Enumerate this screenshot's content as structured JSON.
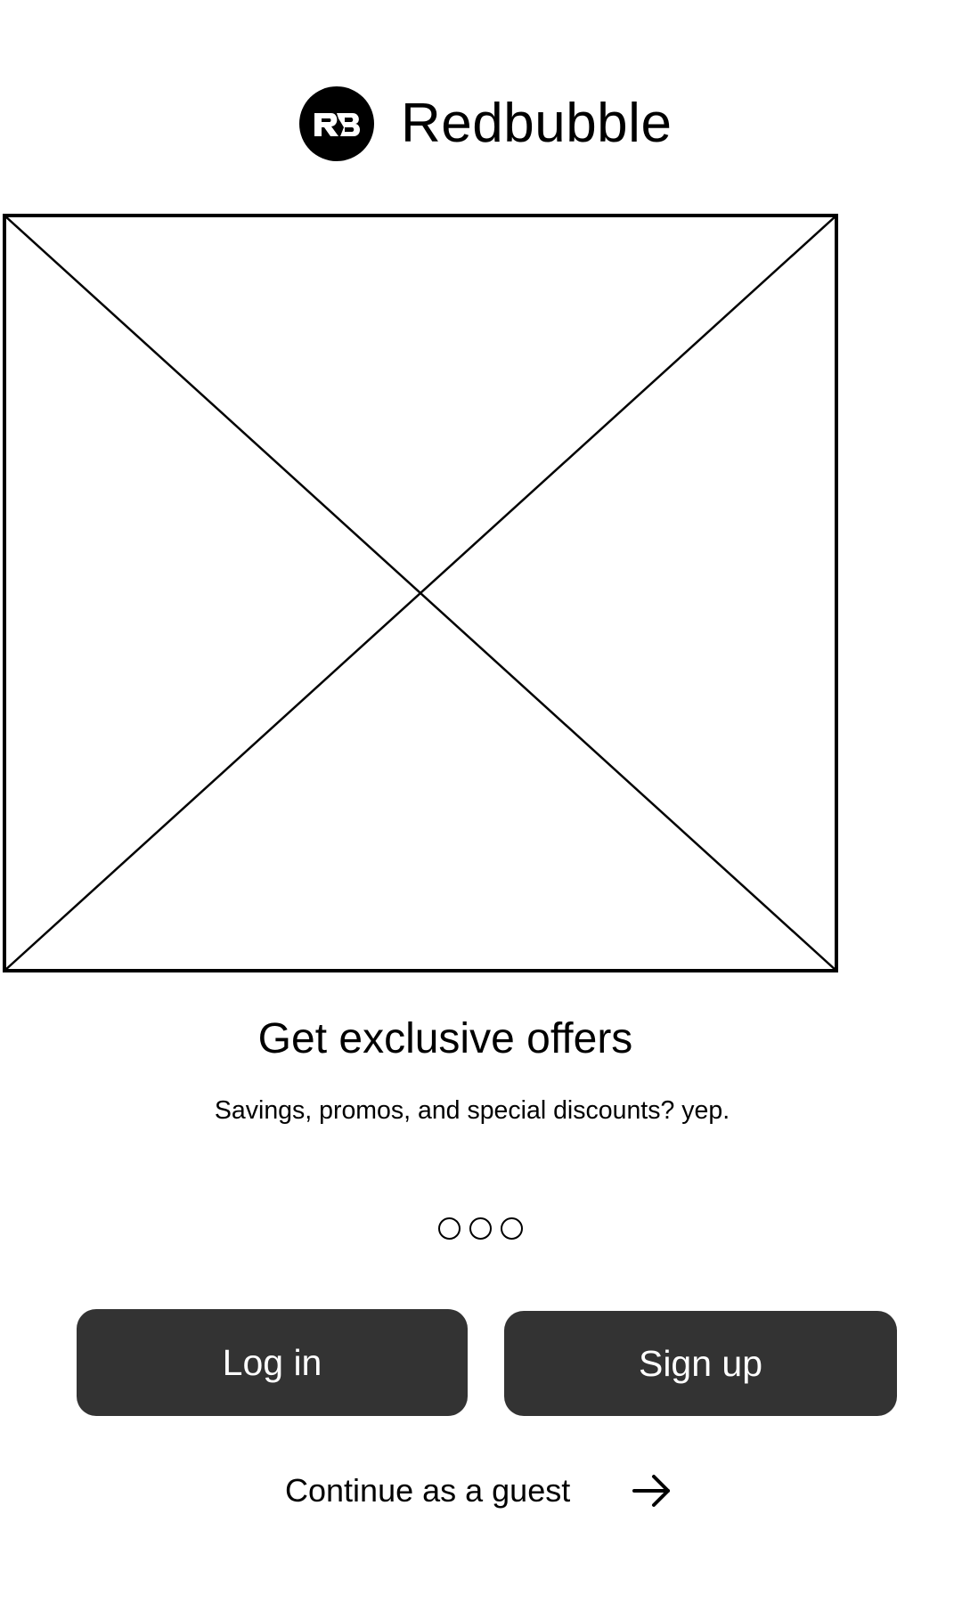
{
  "brand": {
    "logo_icon": "redbubble-logo-icon",
    "name": "Redbubble"
  },
  "hero": {
    "image_icon": "image-placeholder-icon"
  },
  "onboarding": {
    "headline": "Get exclusive offers",
    "subtext": "Savings, promos, and special discounts? yep.",
    "pager": {
      "total_pages": 3
    }
  },
  "actions": {
    "login_label": "Log in",
    "signup_label": "Sign up",
    "guest_label": "Continue as a guest",
    "guest_icon": "arrow-right-icon"
  },
  "colors": {
    "button_background": "#333333",
    "button_text": "#ffffff",
    "page_background": "#ffffff",
    "text": "#000000"
  }
}
